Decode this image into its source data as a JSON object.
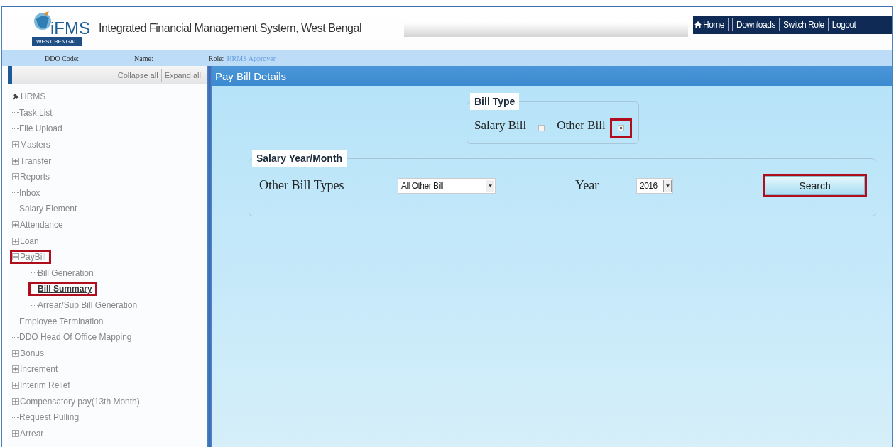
{
  "header": {
    "logo_text": "iFMS",
    "logo_subtext": "WEST BENGAL",
    "title": "Integrated Financial Management System, West Bengal",
    "nav_links": [
      {
        "label": "Home",
        "kind": "home"
      },
      {
        "label": "Downloads",
        "kind": "link"
      },
      {
        "label": "Switch Role",
        "kind": "link"
      },
      {
        "label": "Logout",
        "kind": "link"
      }
    ]
  },
  "info_bar": {
    "fields": [
      {
        "label": "DDO Code:"
      },
      {
        "label": "Name:"
      },
      {
        "label": "Role:",
        "value": "HRMS Approver"
      }
    ]
  },
  "sidebar": {
    "actions": [
      "Collapse all",
      "Expand all"
    ],
    "tree": {
      "label": "HRMS",
      "children": [
        {
          "label": "Task List",
          "selected": false
        },
        {
          "label": "File Upload",
          "selected": false
        },
        {
          "label": "Masters",
          "expanded": false,
          "selected": false
        },
        {
          "label": "Transfer",
          "expanded": false,
          "selected": false
        },
        {
          "label": "Reports",
          "expanded": false,
          "selected": false
        },
        {
          "label": "Inbox",
          "selected": false
        },
        {
          "label": "Salary Element",
          "selected": false
        },
        {
          "label": "Attendance",
          "expanded": false,
          "selected": false
        },
        {
          "label": "Loan",
          "expanded": false,
          "selected": false
        },
        {
          "label": "PayBill",
          "expanded": true,
          "selected": false,
          "highlighted": true,
          "children": [
            {
              "label": "Bill Generation",
              "selected": false
            },
            {
              "label": "Bill Summary",
              "selected": true,
              "highlighted": true
            },
            {
              "label": "Arrear/Sup Bill Generation",
              "selected": false
            }
          ]
        },
        {
          "label": "Employee Termination",
          "selected": false
        },
        {
          "label": "DDO Head Of Office Mapping",
          "selected": false
        },
        {
          "label": "Bonus",
          "expanded": false,
          "selected": false
        },
        {
          "label": "Increment",
          "expanded": false,
          "selected": false
        },
        {
          "label": "Interim Relief",
          "expanded": false,
          "selected": false
        },
        {
          "label": "Compensatory pay(13th Month)",
          "expanded": false,
          "selected": false
        },
        {
          "label": "Request Pulling",
          "selected": false
        },
        {
          "label": "Arrear",
          "expanded": false,
          "selected": false
        }
      ]
    }
  },
  "main": {
    "title": "Pay Bill Details",
    "bill_type": {
      "legend": "Bill Type",
      "options": [
        {
          "label": "Salary Bill",
          "selected": false
        },
        {
          "label": "Other Bill",
          "selected": true,
          "highlighted": true
        }
      ]
    },
    "salary_year_month": {
      "legend": "Salary Year/Month",
      "fields": [
        {
          "label": "Other Bill Types",
          "value": "All Other Bill"
        },
        {
          "label": "Year",
          "value": "2016"
        }
      ],
      "search_button": {
        "label": "Search",
        "highlighted": true
      }
    }
  }
}
